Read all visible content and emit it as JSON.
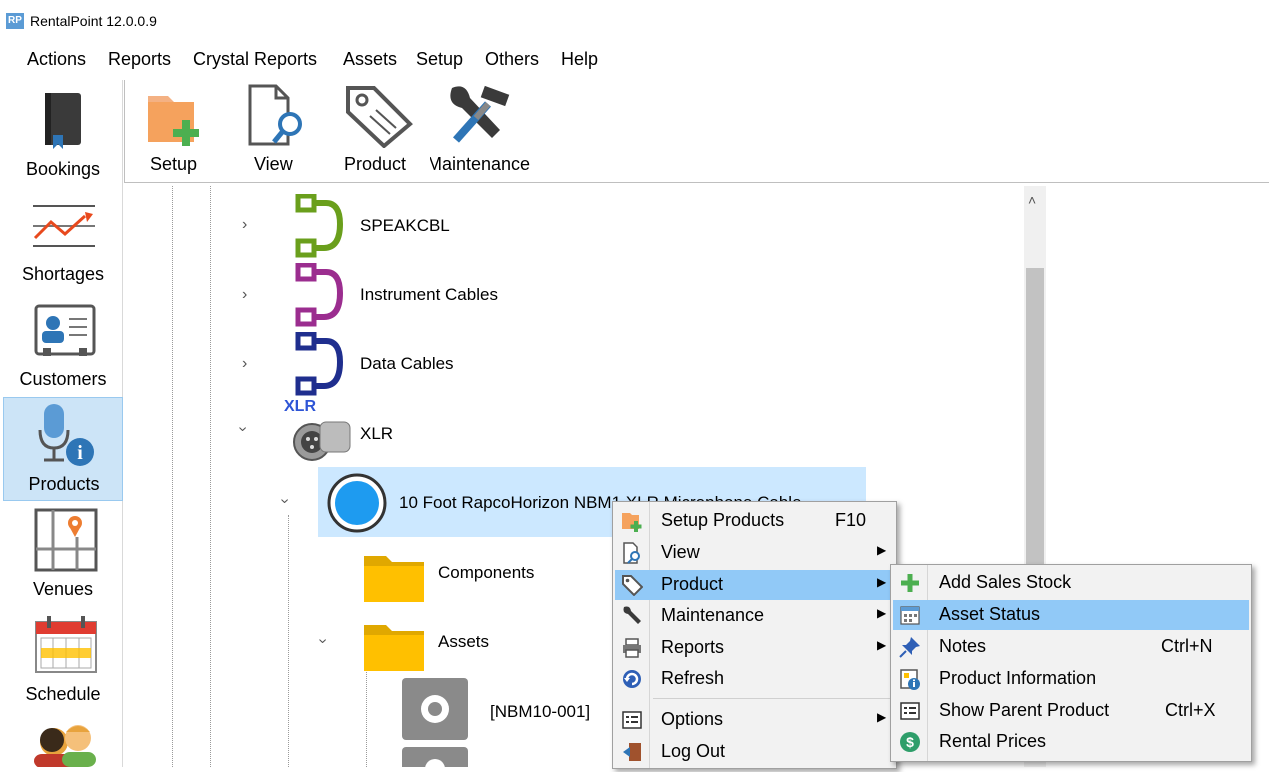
{
  "window": {
    "logo": "RP",
    "title": "RentalPoint 12.0.0.9"
  },
  "menu": [
    "Actions",
    "Reports",
    "Crystal Reports",
    "Assets",
    "Setup",
    "Others",
    "Help"
  ],
  "sidebar": [
    {
      "label": "Bookings",
      "icon": "book-icon"
    },
    {
      "label": "Shortages",
      "icon": "chart-line-icon"
    },
    {
      "label": "Customers",
      "icon": "contact-card-icon"
    },
    {
      "label": "Products",
      "icon": "microphone-info-icon"
    },
    {
      "label": "Venues",
      "icon": "map-pin-icon"
    },
    {
      "label": "Schedule",
      "icon": "calendar-icon"
    }
  ],
  "toolbar": [
    {
      "label": "Setup",
      "icon": "folder-add-icon"
    },
    {
      "label": "View",
      "icon": "document-search-icon"
    },
    {
      "label": "Product",
      "icon": "tag-icon"
    },
    {
      "label": "Maintenance",
      "icon": "tools-icon"
    }
  ],
  "tree": {
    "items": [
      {
        "label": "SPEAKCBL",
        "color": "#6a9f1c"
      },
      {
        "label": "Instrument Cables",
        "color": "#9b2d8f"
      },
      {
        "label": "Data Cables",
        "color": "#1f2e8e"
      },
      {
        "label": "XLR",
        "badge": "XLR"
      },
      {
        "label": "10 Foot RapcoHorizon NBM1 XLR Microphone Cable"
      },
      {
        "label": "Components"
      },
      {
        "label": "Assets"
      },
      {
        "label": "[NBM10-001]"
      }
    ]
  },
  "context_menu": [
    {
      "label": "Setup Products",
      "shortcut": "F10",
      "icon": "folder-add-icon"
    },
    {
      "label": "View",
      "submenu": true,
      "icon": "document-search-icon"
    },
    {
      "label": "Product",
      "submenu": true,
      "icon": "tag-icon",
      "highlighted": true
    },
    {
      "label": "Maintenance",
      "submenu": true,
      "icon": "wrench-icon"
    },
    {
      "label": "Reports",
      "submenu": true,
      "icon": "printer-icon"
    },
    {
      "label": "Refresh",
      "icon": "refresh-icon"
    },
    {
      "label": "Options",
      "submenu": true,
      "icon": "options-icon"
    },
    {
      "label": "Log Out",
      "icon": "logout-icon"
    }
  ],
  "submenu": [
    {
      "label": "Add Sales Stock",
      "icon": "plus-icon"
    },
    {
      "label": "Asset Status",
      "icon": "asset-status-icon",
      "highlighted": true
    },
    {
      "label": "Notes",
      "shortcut": "Ctrl+N",
      "icon": "pin-icon"
    },
    {
      "label": "Product Information",
      "icon": "info-icon"
    },
    {
      "label": "Show Parent Product",
      "shortcut": "Ctrl+X",
      "icon": "list-icon"
    },
    {
      "label": "Rental Prices",
      "icon": "dollar-icon"
    }
  ],
  "colors": {
    "selection": "#cce8ff",
    "highlight": "#91c9f7",
    "menu_bg": "#f2f2f2",
    "folder": "#ffc000"
  }
}
